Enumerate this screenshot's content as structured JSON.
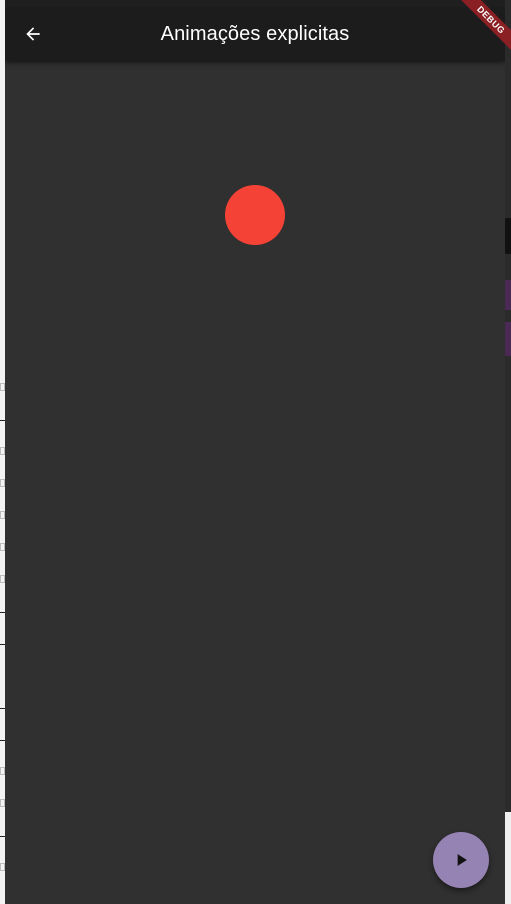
{
  "appbar": {
    "title": "Animações explicitas",
    "back_icon": "arrow-back-icon"
  },
  "debug_banner": {
    "label": "DEBUG"
  },
  "animated_ball": {
    "color": "#f44336"
  },
  "fab": {
    "icon": "play-icon",
    "color": "#9583b3"
  },
  "theme": {
    "background": "#303030",
    "appbar_color": "#1c1c1c"
  }
}
